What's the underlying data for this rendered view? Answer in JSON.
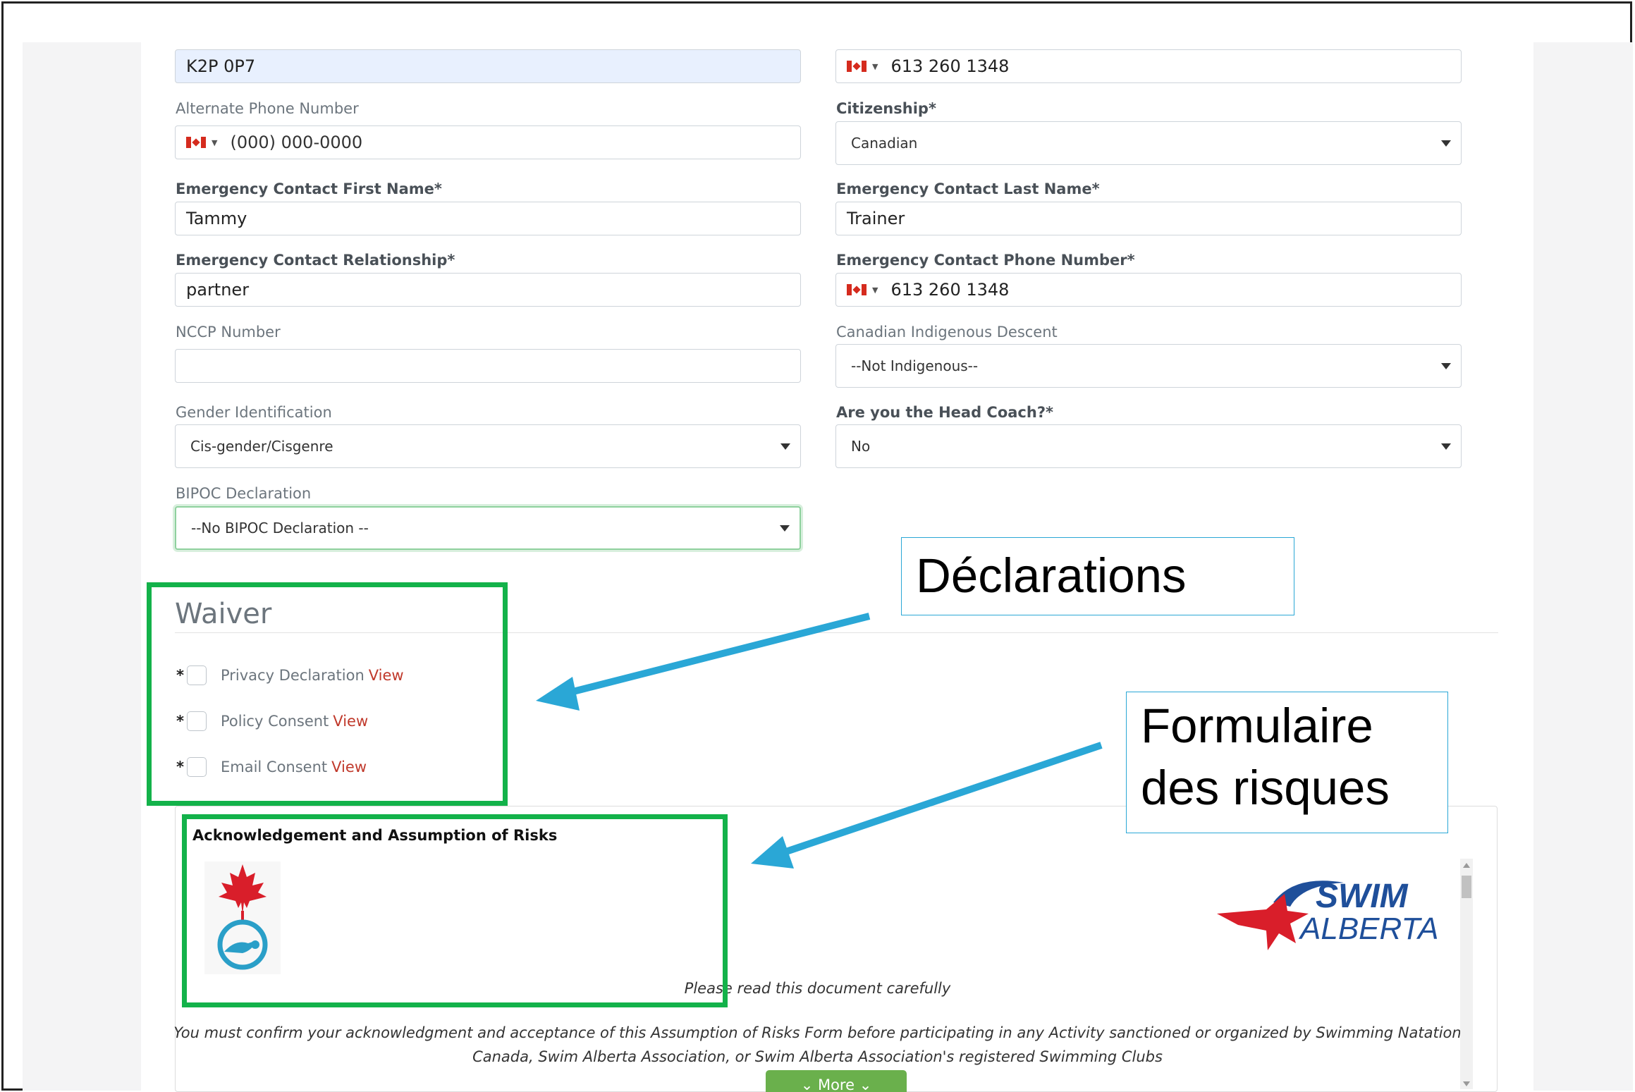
{
  "form": {
    "postal_code_value": "K2P 0P7",
    "primary_phone_value": "613 260 1348",
    "alternate_phone_label": "Alternate Phone Number",
    "alternate_phone_placeholder": "(000) 000-0000",
    "citizenship_label": "Citizenship*",
    "citizenship_value": "Canadian",
    "ec_first_label": "Emergency Contact First Name*",
    "ec_first_value": "Tammy",
    "ec_last_label": "Emergency Contact Last Name*",
    "ec_last_value": "Trainer",
    "ec_rel_label": "Emergency Contact Relationship*",
    "ec_rel_value": "partner",
    "ec_phone_label": "Emergency Contact Phone Number*",
    "ec_phone_value": "613 260 1348",
    "nccp_label": "NCCP Number",
    "nccp_value": "",
    "indigenous_label": "Canadian Indigenous Descent",
    "indigenous_value": "--Not Indigenous--",
    "gender_label": "Gender Identification",
    "gender_value": "Cis-gender/Cisgenre",
    "headcoach_label": "Are you the Head Coach?*",
    "headcoach_value": "No",
    "bipoc_label": "BIPOC Declaration",
    "bipoc_value": "--No BIPOC Declaration --"
  },
  "waiver": {
    "title": "Waiver",
    "items": [
      {
        "star": "*",
        "label": "Privacy Declaration",
        "view": "View"
      },
      {
        "star": "*",
        "label": "Policy Consent",
        "view": "View"
      },
      {
        "star": "*",
        "label": "Email Consent",
        "view": "View"
      }
    ]
  },
  "document": {
    "title": "Acknowledgement and Assumption of Risks",
    "read_note": "Please read this document carefully",
    "confirm_line1": "You must confirm your acknowledgment and acceptance of this Assumption of Risks Form before participating in any Activity sanctioned or organized by Swimming Natation",
    "confirm_line2": "Canada, Swim Alberta Association, or Swim Alberta Association's registered Swimming Clubs",
    "swim_logo_word1": "SWIM",
    "swim_logo_word2": "ALBERTA",
    "more_label": "More"
  },
  "annotations": {
    "declarations": "Déclarations",
    "risk_form_line1": "Formulaire",
    "risk_form_line2": "des risques"
  },
  "colors": {
    "annotation_green": "#13b24a",
    "annotation_blue": "#2aa7d6",
    "view_link": "#c0392b",
    "more_button": "#6ab04c"
  }
}
